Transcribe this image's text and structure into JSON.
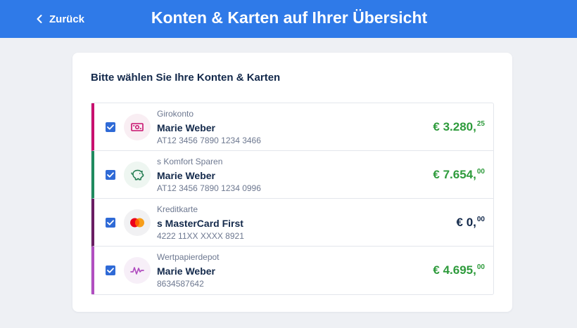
{
  "header": {
    "back_label": "Zurück",
    "title": "Konten & Karten auf Ihrer Übersicht",
    "background_color": "#2f7ae8"
  },
  "card": {
    "title": "Bitte wählen Sie Ihre Konten & Karten"
  },
  "accounts": [
    {
      "type": "Girokonto",
      "name": "Marie Weber",
      "number": "AT12 3456 7890 1234 3466",
      "amount_main": "€ 3.280,",
      "amount_cents": "25",
      "amount_color": "#2e9b3c",
      "accent_color": "#c8106e",
      "icon": "banknote-icon",
      "checked": true
    },
    {
      "type": "s Komfort Sparen",
      "name": "Marie Weber",
      "number": "AT12 3456 7890 1234 0996",
      "amount_main": "€ 7.654,",
      "amount_cents": "00",
      "amount_color": "#2e9b3c",
      "accent_color": "#1f8a5e",
      "icon": "piggy-bank-icon",
      "checked": true
    },
    {
      "type": "Kreditkarte",
      "name": "s MasterCard First",
      "number": "4222 11XX XXXX 8921",
      "amount_main": "€ 0,",
      "amount_cents": "00",
      "amount_color": "#13294b",
      "accent_color": "#6a1d62",
      "icon": "mastercard-icon",
      "checked": true
    },
    {
      "type": "Wertpapierdepot",
      "name": "Marie Weber",
      "number": "8634587642",
      "amount_main": "€ 4.695,",
      "amount_cents": "00",
      "amount_color": "#2e9b3c",
      "accent_color": "#b14fc0",
      "icon": "chart-line-icon",
      "checked": true
    }
  ]
}
